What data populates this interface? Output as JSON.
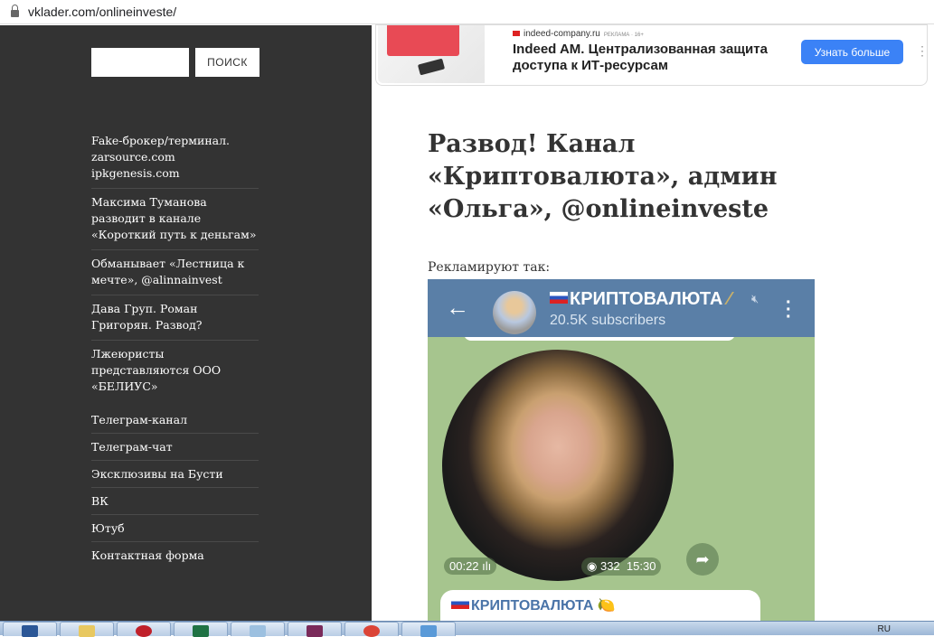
{
  "browser": {
    "url": "vklader.com/onlineinveste/"
  },
  "sidebar": {
    "search_button": "ПОИСК",
    "search_value": "",
    "recent_posts": [
      "Fake-брокер/терминал. zarsource.com ipkgenesis.com",
      "Максима Туманова разводит в канале «Короткий путь к деньгам»",
      "Обманывает «Лестница к мечте», @alinnainvest",
      "Дава Груп. Роман Григорян. Развод?",
      "Лжеюристы представляются ООО «БЕЛИУС»"
    ],
    "links": [
      "Телеграм-канал",
      "Телеграм-чат",
      "Эксклюзивы на Бусти",
      "ВК",
      "Ютуб",
      "Контактная форма"
    ]
  },
  "ad": {
    "domain": "indeed-company.ru",
    "label": "РЕКЛАМА · 16+",
    "title": "Indeed AM. Централизованная защита доступа к ИТ-ресурсам",
    "button": "Узнать больше"
  },
  "article": {
    "title": "Развод! Канал «Криптовалюта», админ «Ольга», @onlineinveste",
    "intro": "Рекламируют так:"
  },
  "telegram": {
    "channel": "КРИПТОВАЛЮТА",
    "subscribers": "20.5K subscribers",
    "duration": "00:22",
    "views": "332",
    "time": "15:30",
    "message_title": "КРИПТОВАЛЮТА"
  },
  "taskbar": {
    "lang": "RU"
  }
}
